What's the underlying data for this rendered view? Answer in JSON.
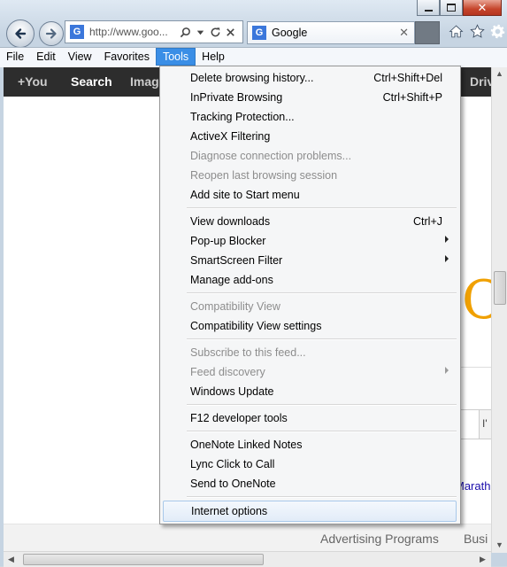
{
  "address": {
    "url": "http://www.goo..."
  },
  "tab": {
    "favicon": "G",
    "title": "Google"
  },
  "menubar": {
    "items": [
      "File",
      "Edit",
      "View",
      "Favorites",
      "Tools",
      "Help"
    ],
    "active": "Tools"
  },
  "google_bar": {
    "items": [
      "+You",
      "Search",
      "Imag",
      "Driv"
    ],
    "current": "Search"
  },
  "page": {
    "logo_fragment": "C",
    "button_fragment": "I'",
    "link_fragment": "Marath",
    "footer_links": [
      "Advertising Programs",
      "Busi"
    ]
  },
  "tools_menu": {
    "groups": [
      [
        {
          "label": "Delete browsing history...",
          "shortcut": "Ctrl+Shift+Del"
        },
        {
          "label": "InPrivate Browsing",
          "shortcut": "Ctrl+Shift+P"
        },
        {
          "label": "Tracking Protection..."
        },
        {
          "label": "ActiveX Filtering"
        },
        {
          "label": "Diagnose connection problems...",
          "disabled": true
        },
        {
          "label": "Reopen last browsing session",
          "disabled": true
        },
        {
          "label": "Add site to Start menu"
        }
      ],
      [
        {
          "label": "View downloads",
          "shortcut": "Ctrl+J"
        },
        {
          "label": "Pop-up Blocker",
          "submenu": true
        },
        {
          "label": "SmartScreen Filter",
          "submenu": true
        },
        {
          "label": "Manage add-ons"
        }
      ],
      [
        {
          "label": "Compatibility View",
          "disabled": true
        },
        {
          "label": "Compatibility View settings"
        }
      ],
      [
        {
          "label": "Subscribe to this feed...",
          "disabled": true
        },
        {
          "label": "Feed discovery",
          "disabled": true,
          "submenu": true
        },
        {
          "label": "Windows Update"
        }
      ],
      [
        {
          "label": "F12 developer tools"
        }
      ],
      [
        {
          "label": "OneNote Linked Notes"
        },
        {
          "label": "Lync Click to Call"
        },
        {
          "label": "Send to OneNote"
        }
      ],
      [
        {
          "label": "Internet options",
          "highlighted": true
        }
      ]
    ]
  },
  "icons": {
    "back": "back-arrow-icon",
    "forward": "forward-arrow-icon",
    "search": "search-icon",
    "refresh": "refresh-icon",
    "stop": "stop-icon",
    "home": "home-icon",
    "favorites": "star-icon",
    "tools": "gear-icon"
  }
}
